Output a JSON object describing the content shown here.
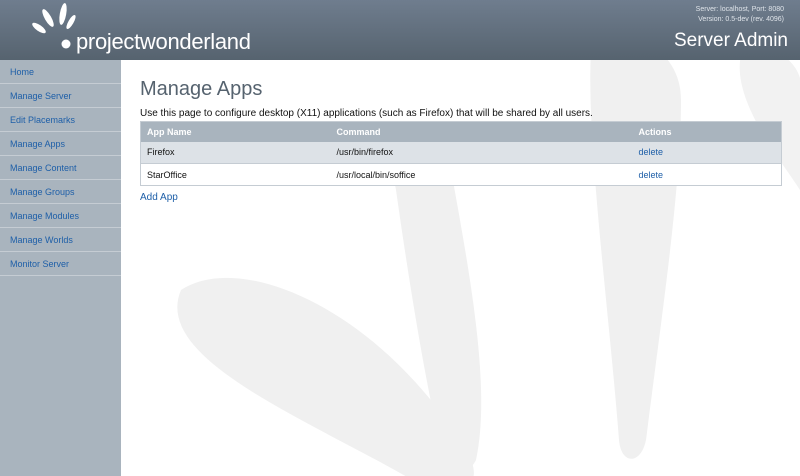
{
  "header": {
    "logo_text": "projectwonderland",
    "server_info_line1": "Server: localhost, Port: 8080",
    "server_info_line2": "Version: 0.5-dev (rev. 4096)",
    "title": "Server Admin"
  },
  "sidebar": {
    "items": [
      {
        "label": "Home"
      },
      {
        "label": "Manage Server"
      },
      {
        "label": "Edit Placemarks"
      },
      {
        "label": "Manage Apps"
      },
      {
        "label": "Manage Content"
      },
      {
        "label": "Manage Groups"
      },
      {
        "label": "Manage Modules"
      },
      {
        "label": "Manage Worlds"
      },
      {
        "label": "Monitor Server"
      }
    ]
  },
  "main": {
    "title": "Manage Apps",
    "description": "Use this page to configure desktop (X11) applications (such as Firefox) that will be shared by all users.",
    "table": {
      "columns": [
        "App Name",
        "Command",
        "Actions"
      ],
      "rows": [
        {
          "name": "Firefox",
          "command": "/usr/bin/firefox",
          "action": "delete"
        },
        {
          "name": "StarOffice",
          "command": "/usr/local/bin/soffice",
          "action": "delete"
        }
      ]
    },
    "add_label": "Add App"
  },
  "colors": {
    "header": "#5f6c79",
    "sidebar": "#a9b4be",
    "link": "#1e5fa8",
    "title": "#56636f"
  }
}
